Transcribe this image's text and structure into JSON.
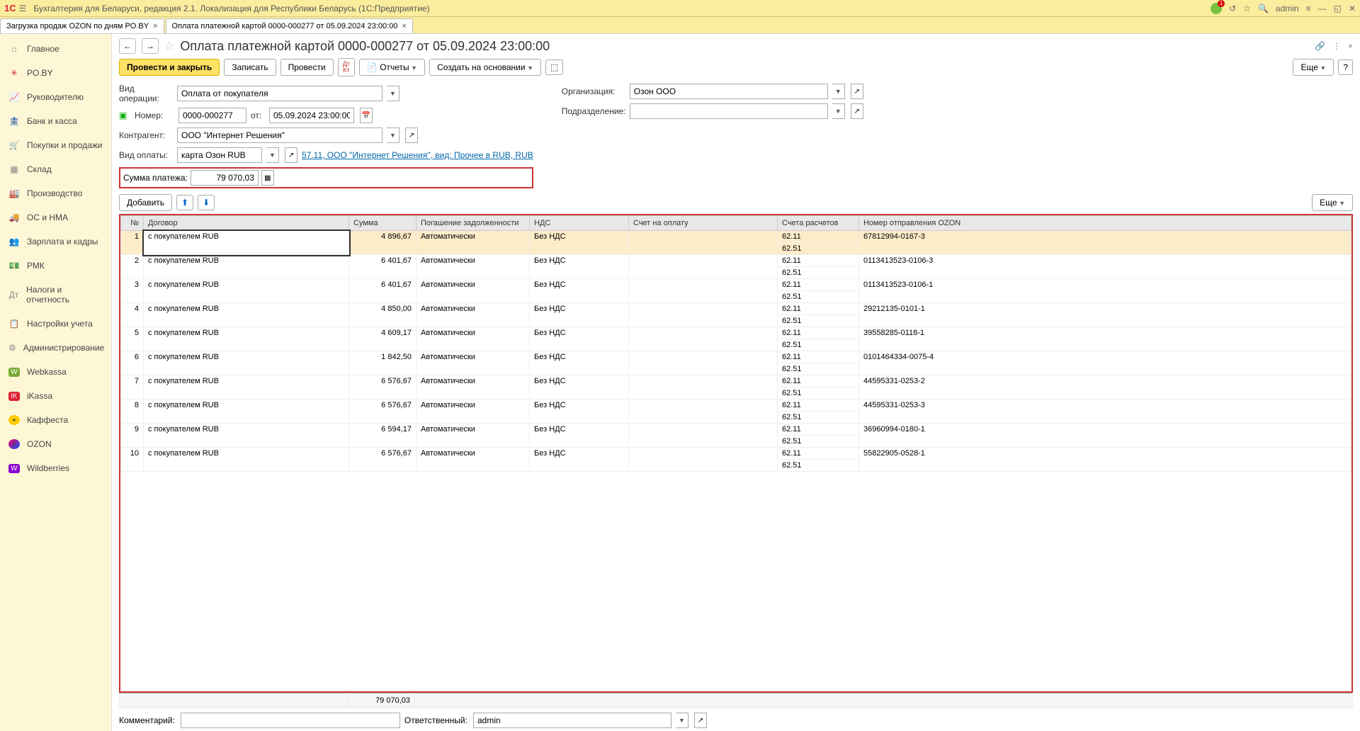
{
  "titlebar": {
    "app_title": "Бухгалтерия для Беларуси, редакция 2.1. Локализация для Республики Беларусь   (1С:Предприятие)",
    "user": "admin"
  },
  "tabs": [
    {
      "label": "Загрузка продаж OZON по дням PO.BY"
    },
    {
      "label": "Оплата платежной картой 0000-000277 от 05.09.2024 23:00:00"
    }
  ],
  "sidebar": {
    "items": [
      {
        "icon": "home",
        "label": "Главное"
      },
      {
        "icon": "star",
        "label": "PO.BY"
      },
      {
        "icon": "chart",
        "label": "Руководителю"
      },
      {
        "icon": "bank",
        "label": "Банк и касса"
      },
      {
        "icon": "cart",
        "label": "Покупки и продажи"
      },
      {
        "icon": "boxes",
        "label": "Склад"
      },
      {
        "icon": "factory",
        "label": "Производство"
      },
      {
        "icon": "truck",
        "label": "ОС и НМА"
      },
      {
        "icon": "people",
        "label": "Зарплата и кадры"
      },
      {
        "icon": "cash",
        "label": "РМК"
      },
      {
        "icon": "tax",
        "label": "Налоги и отчетность"
      },
      {
        "icon": "clip",
        "label": "Настройки учета"
      },
      {
        "icon": "gear",
        "label": "Администрирование"
      },
      {
        "icon": "w",
        "label": "Webkassa"
      },
      {
        "icon": "ik",
        "label": "iKassa"
      },
      {
        "icon": "kf",
        "label": "Каффеста"
      },
      {
        "icon": "oz",
        "label": "OZON"
      },
      {
        "icon": "wb",
        "label": "Wildberries"
      }
    ]
  },
  "doc": {
    "title": "Оплата платежной картой 0000-000277 от 05.09.2024 23:00:00",
    "toolbar": {
      "post_close": "Провести и закрыть",
      "save": "Записать",
      "post": "Провести",
      "reports": "Отчеты",
      "create_based": "Создать на основании",
      "more": "Еще"
    },
    "fields": {
      "op_type_label": "Вид операции:",
      "op_type": "Оплата от покупателя",
      "number_label": "Номер:",
      "number": "0000-000277",
      "from_label": "от:",
      "date": "05.09.2024 23:00:00",
      "counterparty_label": "Контрагент:",
      "counterparty": "ООО \"Интернет Решения\"",
      "pay_type_label": "Вид оплаты:",
      "pay_type": "карта Озон RUB",
      "pay_link": "57.11, ООО \"Интернет Решения\", вид: Прочее в RUB, RUB",
      "sum_label": "Сумма платежа:",
      "sum": "79 070,03",
      "org_label": "Организация:",
      "org": "Озон ООО",
      "dept_label": "Подразделение:",
      "dept": ""
    },
    "tbl_toolbar": {
      "add": "Добавить",
      "more": "Еще"
    },
    "columns": {
      "n": "№",
      "contract": "Договор",
      "sum": "Сумма",
      "repay": "Погашение задолженности",
      "vat": "НДС",
      "invoice": "Счет на оплату",
      "accounts": "Счета расчетов",
      "ozon_num": "Номер отправления OZON"
    },
    "rows": [
      {
        "n": "1",
        "contract": "с покупателем RUB",
        "sum": "4 896,67",
        "repay": "Автоматически",
        "vat": "Без НДС",
        "acc1": "62.11",
        "acc2": "62.51",
        "ozon": "67812994-0167-3"
      },
      {
        "n": "2",
        "contract": "с покупателем RUB",
        "sum": "6 401,67",
        "repay": "Автоматически",
        "vat": "Без НДС",
        "acc1": "62.11",
        "acc2": "62.51",
        "ozon": "0113413523-0106-3"
      },
      {
        "n": "3",
        "contract": "с покупателем RUB",
        "sum": "6 401,67",
        "repay": "Автоматически",
        "vat": "Без НДС",
        "acc1": "62.11",
        "acc2": "62.51",
        "ozon": "0113413523-0106-1"
      },
      {
        "n": "4",
        "contract": "с покупателем RUB",
        "sum": "4 850,00",
        "repay": "Автоматически",
        "vat": "Без НДС",
        "acc1": "62.11",
        "acc2": "62.51",
        "ozon": "29212135-0101-1"
      },
      {
        "n": "5",
        "contract": "с покупателем RUB",
        "sum": "4 609,17",
        "repay": "Автоматически",
        "vat": "Без НДС",
        "acc1": "62.11",
        "acc2": "62.51",
        "ozon": "39558285-0118-1"
      },
      {
        "n": "6",
        "contract": "с покупателем RUB",
        "sum": "1 842,50",
        "repay": "Автоматически",
        "vat": "Без НДС",
        "acc1": "62.11",
        "acc2": "62.51",
        "ozon": "0101464334-0075-4"
      },
      {
        "n": "7",
        "contract": "с покупателем RUB",
        "sum": "6 576,67",
        "repay": "Автоматически",
        "vat": "Без НДС",
        "acc1": "62.11",
        "acc2": "62.51",
        "ozon": "44595331-0253-2"
      },
      {
        "n": "8",
        "contract": "с покупателем RUB",
        "sum": "6 576,67",
        "repay": "Автоматически",
        "vat": "Без НДС",
        "acc1": "62.11",
        "acc2": "62.51",
        "ozon": "44595331-0253-3"
      },
      {
        "n": "9",
        "contract": "с покупателем RUB",
        "sum": "6 594,17",
        "repay": "Автоматически",
        "vat": "Без НДС",
        "acc1": "62.11",
        "acc2": "62.51",
        "ozon": "36960994-0180-1"
      },
      {
        "n": "10",
        "contract": "с покупателем RUB",
        "sum": "6 576,67",
        "repay": "Автоматически",
        "vat": "Без НДС",
        "acc1": "62.11",
        "acc2": "62.51",
        "ozon": "55822905-0528-1"
      }
    ],
    "footer_sum": "79 070,03",
    "comment_label": "Комментарий:",
    "comment": "",
    "responsible_label": "Ответственный:",
    "responsible": "admin"
  },
  "help": "?"
}
